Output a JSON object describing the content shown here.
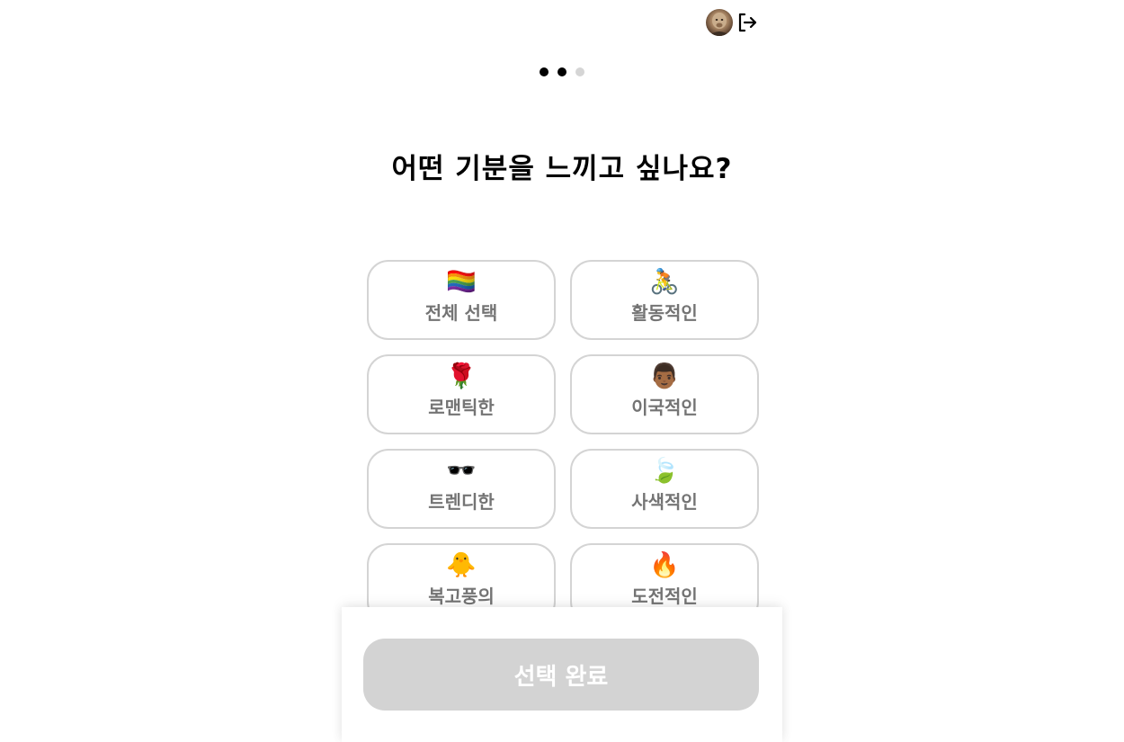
{
  "header": {
    "avatar_icon": "profile-photo",
    "logout_icon": "logout-icon"
  },
  "progress": {
    "steps_total": 3,
    "current_step": 2
  },
  "title": "어떤 기분을 느끼고 싶나요?",
  "moods": [
    {
      "icon": "🏳️‍🌈",
      "label": "전체 선택"
    },
    {
      "icon": "🚴",
      "label": "활동적인"
    },
    {
      "icon": "🌹",
      "label": "로맨틱한"
    },
    {
      "icon": "👨🏾",
      "label": "이국적인"
    },
    {
      "icon": "🕶️",
      "label": "트렌디한"
    },
    {
      "icon": "🍃",
      "label": "사색적인"
    },
    {
      "icon": "🐥",
      "label": "복고풍의"
    },
    {
      "icon": "🔥",
      "label": "도전적인"
    }
  ],
  "footer": {
    "submit_label": "선택 완료"
  },
  "colors": {
    "card_border": "#d4d4d4",
    "card_label": "#747474",
    "button_disabled": "#d3d3d3",
    "dot_active": "#000000",
    "dot_inactive": "#d5d5d5"
  }
}
